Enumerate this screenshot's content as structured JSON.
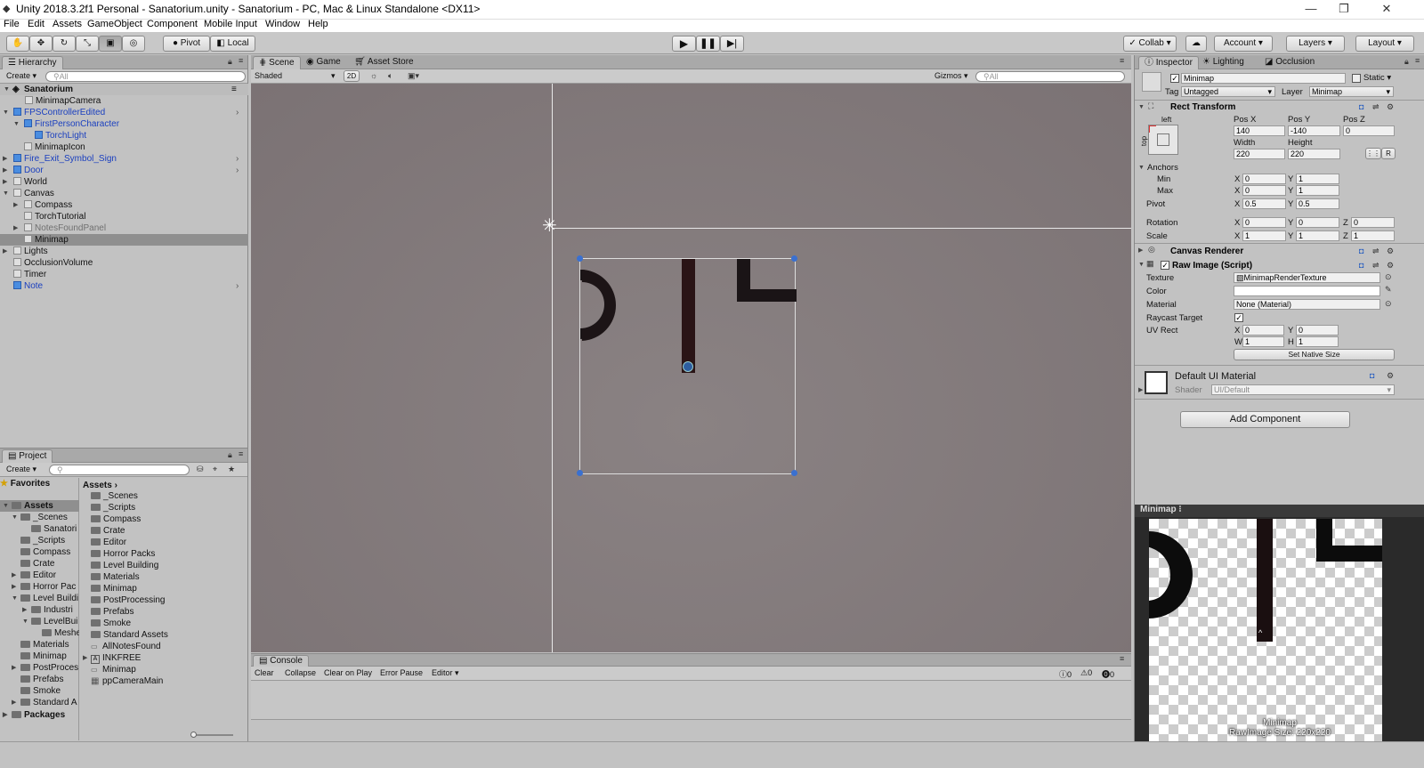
{
  "window": {
    "title": "Unity 2018.3.2f1 Personal - Sanatorium.unity - Sanatorium - PC, Mac & Linux Standalone <DX11>"
  },
  "menu": [
    "File",
    "Edit",
    "Assets",
    "GameObject",
    "Component",
    "Mobile Input",
    "Window",
    "Help"
  ],
  "toolbar": {
    "pivot": "Pivot",
    "local": "Local",
    "collab": "Collab",
    "account": "Account",
    "layers": "Layers",
    "layout": "Layout"
  },
  "hierarchy": {
    "tab": "Hierarchy",
    "create": "Create",
    "search": "All",
    "scene": "Sanatorium",
    "items": [
      "MinimapCamera",
      "FPSControllerEdited",
      "FirstPersonCharacter",
      "TorchLight",
      "MinimapIcon",
      "Fire_Exit_Symbol_Sign",
      "Door",
      "World",
      "Canvas",
      "Compass",
      "TorchTutorial",
      "NotesFoundPanel",
      "Minimap",
      "Lights",
      "OcclusionVolume",
      "Timer",
      "Note"
    ]
  },
  "project": {
    "tab": "Project",
    "create": "Create",
    "favorites": "Favorites",
    "assets": "Assets",
    "packages": "Packages",
    "tree": [
      "_Scenes",
      "Sanatori",
      "_Scripts",
      "Compass",
      "Crate",
      "Editor",
      "Horror Pac",
      "Level Buildi",
      "Industri",
      "LevelBui",
      "Meshe",
      "Materials",
      "Minimap",
      "PostProces",
      "Prefabs",
      "Smoke",
      "Standard A"
    ],
    "breadcrumb": "Assets",
    "list": [
      "_Scenes",
      "_Scripts",
      "Compass",
      "Crate",
      "Editor",
      "Horror Packs",
      "Level Building",
      "Materials",
      "Minimap",
      "PostProcessing",
      "Prefabs",
      "Smoke",
      "Standard Assets",
      "AllNotesFound",
      "INKFREE",
      "Minimap",
      "ppCameraMain"
    ]
  },
  "scene": {
    "tabs": [
      "Scene",
      "Game",
      "Asset Store"
    ],
    "shading": "Shaded",
    "mode2d": "2D",
    "gizmos": "Gizmos",
    "search": "All"
  },
  "console": {
    "tab": "Console",
    "buttons": [
      "Clear",
      "Collapse",
      "Clear on Play",
      "Error Pause",
      "Editor"
    ],
    "counts": [
      "0",
      "0",
      "0"
    ]
  },
  "inspector": {
    "tabs": [
      "Inspector",
      "Lighting",
      "Occlusion"
    ],
    "name": "Minimap",
    "static": "Static",
    "tag_label": "Tag",
    "tag": "Untagged",
    "layer_label": "Layer",
    "layer": "Minimap",
    "rect_transform": "Rect Transform",
    "anchor_h": "left",
    "anchor_v": "top",
    "posx_l": "Pos X",
    "posy_l": "Pos Y",
    "posz_l": "Pos Z",
    "posx": "140",
    "posy": "-140",
    "posz": "0",
    "width_l": "Width",
    "height_l": "Height",
    "width": "220",
    "height": "220",
    "anchors": "Anchors",
    "min": "Min",
    "max": "Max",
    "pivot": "Pivot",
    "rotation": "Rotation",
    "scale": "Scale",
    "min_x": "0",
    "min_y": "1",
    "max_x": "0",
    "max_y": "1",
    "piv_x": "0.5",
    "piv_y": "0.5",
    "rot_x": "0",
    "rot_y": "0",
    "rot_z": "0",
    "sc_x": "1",
    "sc_y": "1",
    "sc_z": "1",
    "canvas_renderer": "Canvas Renderer",
    "raw_image": "Raw Image (Script)",
    "texture_l": "Texture",
    "texture": "MinimapRenderTexture",
    "color_l": "Color",
    "material_l": "Material",
    "material": "None (Material)",
    "raycast_l": "Raycast Target",
    "uvrect_l": "UV Rect",
    "uv_x": "0",
    "uv_y": "0",
    "uv_w": "1",
    "uv_h": "1",
    "native_size": "Set Native Size",
    "default_mat": "Default UI Material",
    "shader_l": "Shader",
    "shader": "UI/Default",
    "add_component": "Add Component",
    "X": "X",
    "Y": "Y",
    "Z": "Z",
    "W": "W",
    "H": "H",
    "R": "R"
  },
  "preview": {
    "title": "Minimap",
    "caption1": "Minimap",
    "caption2": "RawImage Size: 220x220"
  },
  "colors": {
    "scene_bg": "#837a7c",
    "panel": "#c2c2c2",
    "selection": "#8f8f8f",
    "blue_prefab": "#1a3fbf"
  }
}
